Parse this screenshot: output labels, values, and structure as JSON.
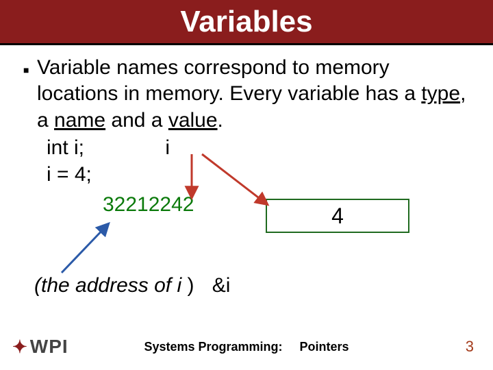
{
  "title": "Variables",
  "body": {
    "text_before_type": "Variable names correspond to memory locations in memory. Every variable has a ",
    "word_type": "type",
    "text_mid1": ", a ",
    "word_name": "name",
    "text_mid2": " and a ",
    "word_value": "value",
    "text_after": ".",
    "line_decl": "int i;",
    "label_i": "i",
    "line_assign": "i = 4;",
    "address_number": "32212242",
    "box_value": "4",
    "caption_italic": "(the address of i ",
    "caption_close": ")",
    "caption_amp": "&i"
  },
  "footer": {
    "logo_text": "WPI",
    "course": "Systems Programming:",
    "topic": "Pointers",
    "page": "3"
  },
  "colors": {
    "band": "#8a1d1d",
    "green": "#0b7a0b",
    "red_arrow": "#c0392b",
    "blue_arrow": "#2b5aa8"
  }
}
